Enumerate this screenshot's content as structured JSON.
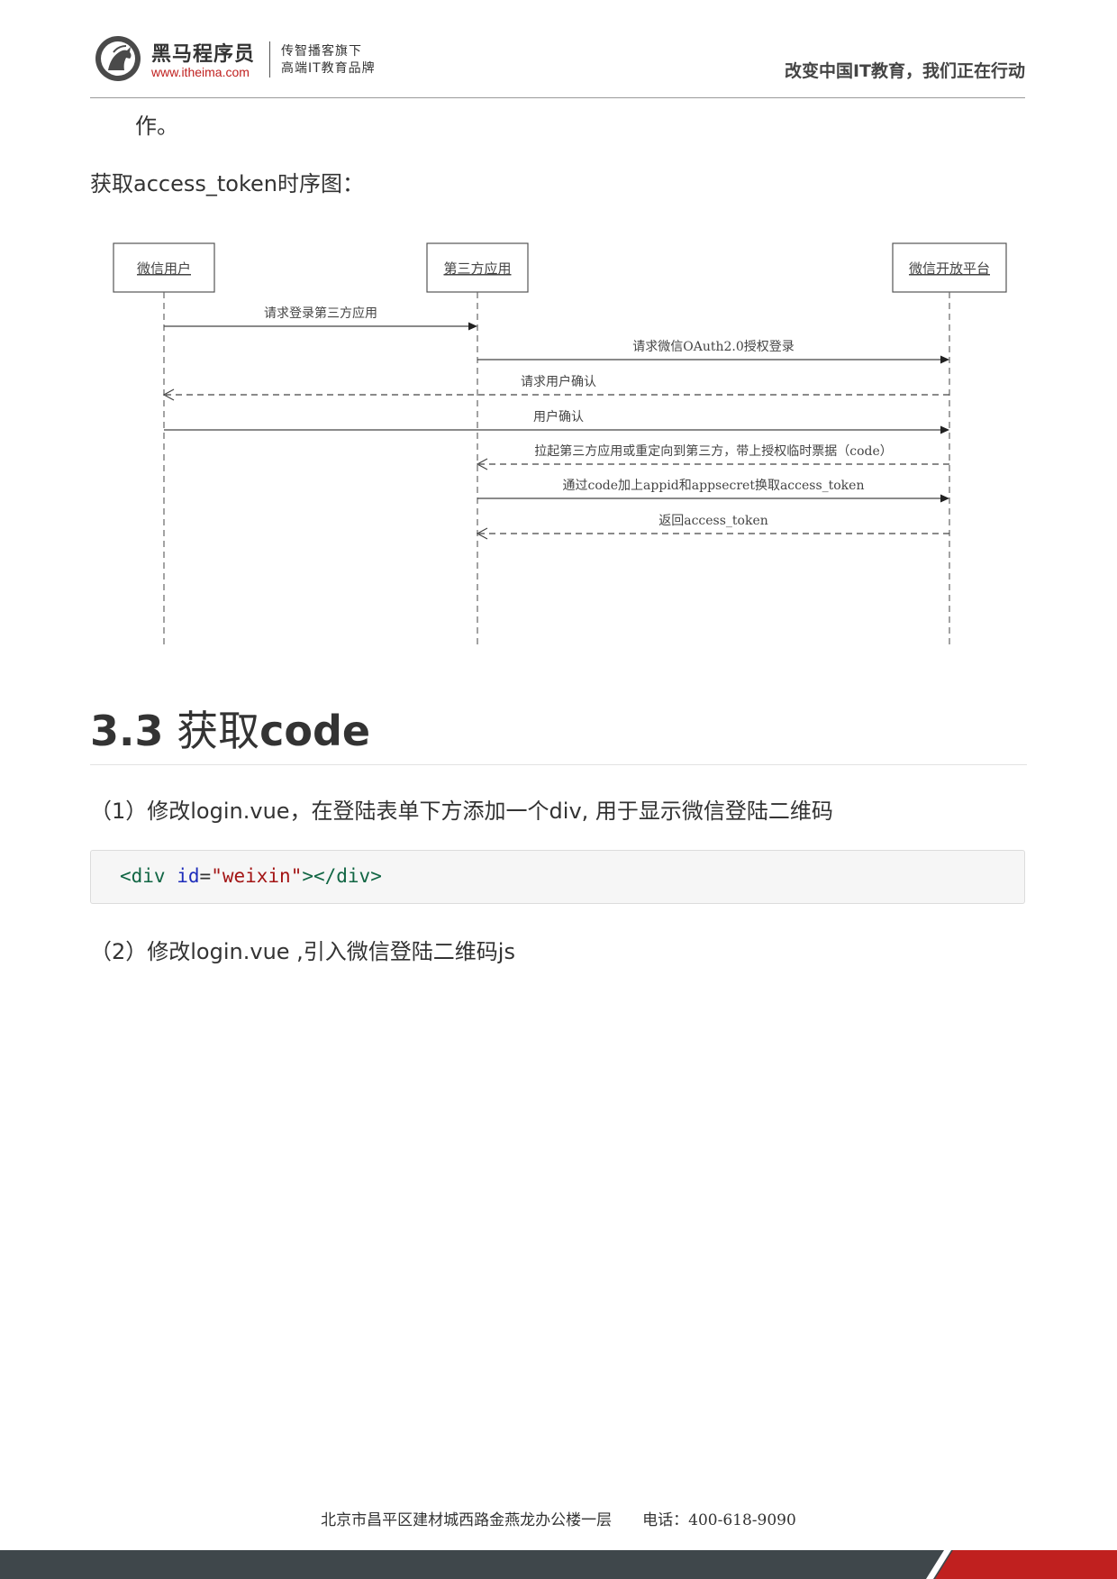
{
  "header": {
    "brand_name": "黑马程序员",
    "brand_url": "www.itheima.com",
    "slogan_line1": "传智播客旗下",
    "slogan_line2": "高端IT教育品牌",
    "tagline": "改变中国IT教育，我们正在行动"
  },
  "content": {
    "continuation": "作。",
    "diagram_caption": "获取access_token时序图："
  },
  "diagram": {
    "participants": [
      "微信用户",
      "第三方应用",
      "微信开放平台"
    ],
    "messages": [
      {
        "label": "请求登录第三方应用",
        "from": 0,
        "to": 1,
        "style": "solid"
      },
      {
        "label": "请求微信OAuth2.0授权登录",
        "from": 1,
        "to": 2,
        "style": "solid"
      },
      {
        "label": "请求用户确认",
        "from": 2,
        "to": 0,
        "style": "dashed"
      },
      {
        "label": "用户确认",
        "from": 0,
        "to": 2,
        "style": "solid"
      },
      {
        "label": "拉起第三方应用或重定向到第三方，带上授权临时票据（code）",
        "from": 2,
        "to": 1,
        "style": "dashed"
      },
      {
        "label": "通过code加上appid和appsecret换取access_token",
        "from": 1,
        "to": 2,
        "style": "solid"
      },
      {
        "label": "返回access_token",
        "from": 2,
        "to": 1,
        "style": "dashed"
      }
    ]
  },
  "section": {
    "number": "3.3",
    "title_cn": "获取",
    "title_en": "code"
  },
  "paragraphs": {
    "step1": "（1）修改login.vue，在登陆表单下方添加一个div, 用于显示微信登陆二维码",
    "step2": "（2）修改login.vue ,引入微信登陆二维码js"
  },
  "code": {
    "open_tag": "<div",
    "attr_name": "id",
    "equals": "=",
    "attr_value": "\"weixin\"",
    "close": "></div>"
  },
  "footer": {
    "address": "北京市昌平区建材城西路金燕龙办公楼一层　　电话：400-618-9090"
  },
  "colors": {
    "brand_red": "#c0201f",
    "footer_dark": "#3f474b",
    "text": "#333333"
  }
}
